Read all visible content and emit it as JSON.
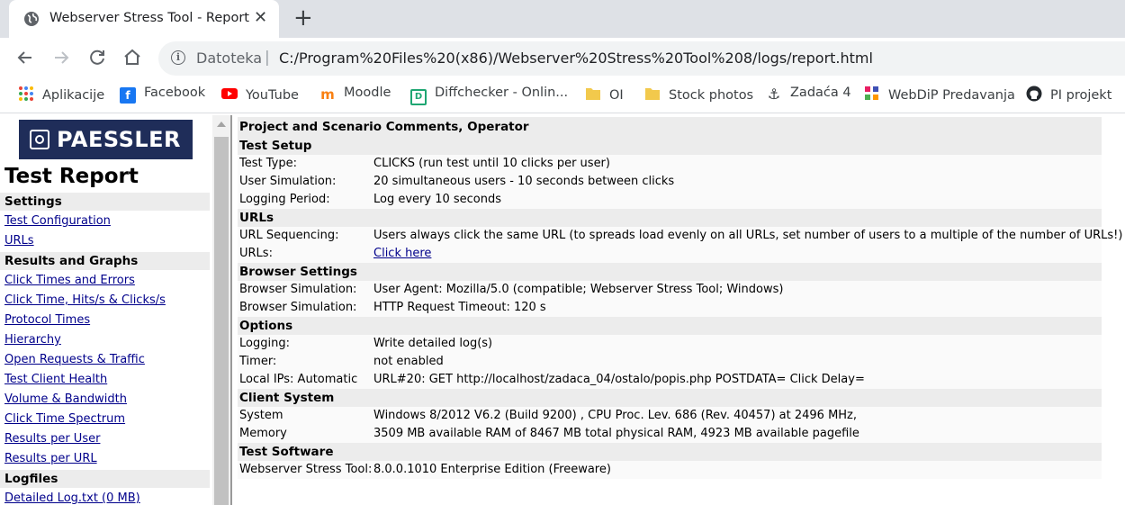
{
  "browser": {
    "tab_title": "Webserver Stress Tool - Report",
    "tab_close": "✕",
    "new_tab": "+",
    "scheme_label": "Datoteka",
    "separator": "|",
    "url": "C:/Program%20Files%20(x86)/Webserver%20Stress%20Tool%208/logs/report.html",
    "icons": [
      "back-icon",
      "forward-icon",
      "reload-icon",
      "home-icon",
      "info-icon"
    ]
  },
  "bookmarks": [
    {
      "label": "Aplikacije",
      "icon": "apps-grid-icon"
    },
    {
      "label": "Facebook",
      "icon": "facebook-icon"
    },
    {
      "label": "YouTube",
      "icon": "youtube-icon"
    },
    {
      "label": "Moodle",
      "icon": "moodle-icon"
    },
    {
      "label": "Diffchecker - Onlin...",
      "icon": "diffchecker-icon"
    },
    {
      "label": "OI",
      "icon": "folder-icon"
    },
    {
      "label": "Stock photos",
      "icon": "folder-icon"
    },
    {
      "label": "Zadaća 4",
      "icon": "anchor-icon"
    },
    {
      "label": "WebDiP Predavanja",
      "icon": "webdip-icon"
    },
    {
      "label": "PI projekt",
      "icon": "github-icon"
    }
  ],
  "sidebar": {
    "logo_text": "PAESSLER",
    "report_title": "Test Report",
    "sections": [
      {
        "heading": "Settings",
        "links": [
          "Test Configuration",
          "URLs"
        ]
      },
      {
        "heading": "Results and Graphs",
        "links": [
          "Click Times and Errors",
          "Click Time, Hits/s & Clicks/s",
          "Protocol Times",
          "Hierarchy",
          "Open Requests & Traffic",
          "Test Client Health",
          "Volume & Bandwidth",
          "Click Time Spectrum",
          "Results per User",
          "Results per URL"
        ]
      },
      {
        "heading": "Logfiles",
        "links": [
          "Detailed Log.txt (0 MB)"
        ]
      }
    ]
  },
  "report": {
    "top_heading": "Project and Scenario Comments, Operator",
    "sections": [
      {
        "heading": "Test Setup",
        "rows": [
          {
            "key": "Test Type:",
            "value": "CLICKS (run test until 10 clicks per user)"
          },
          {
            "key": "User Simulation:",
            "value": "20 simultaneous users - 10 seconds between clicks"
          },
          {
            "key": "Logging Period:",
            "value": "Log every 10 seconds"
          }
        ]
      },
      {
        "heading": "URLs",
        "rows": [
          {
            "key": "URL Sequencing:",
            "value": "Users always click the same URL (to spreads load evenly on all URLs, set number of users to a multiple of the number of URLs!)"
          },
          {
            "key": "URLs:",
            "value": "Click here",
            "link": true
          }
        ]
      },
      {
        "heading": "Browser Settings",
        "rows": [
          {
            "key": "Browser Simulation:",
            "value": "User Agent: Mozilla/5.0 (compatible; Webserver Stress Tool; Windows)"
          },
          {
            "key": "Browser Simulation:",
            "value": "HTTP Request Timeout: 120 s"
          }
        ]
      },
      {
        "heading": "Options",
        "rows": [
          {
            "key": "Logging:",
            "value": "Write detailed log(s)"
          },
          {
            "key": "Timer:",
            "value": "not enabled"
          },
          {
            "key": "Local IPs: Automatic",
            "value": "URL#20: GET http://localhost/zadaca_04/ostalo/popis.php POSTDATA= Click Delay="
          }
        ]
      },
      {
        "heading": "Client System",
        "rows": [
          {
            "key": "System",
            "value": "Windows 8/2012 V6.2 (Build 9200) , CPU Proc. Lev. 686 (Rev. 40457) at 2496 MHz,"
          },
          {
            "key": "Memory",
            "value": "3509 MB available RAM of 8467 MB total physical RAM, 4923 MB available pagefile"
          }
        ]
      },
      {
        "heading": "Test Software",
        "rows": [
          {
            "key": "Webserver Stress Tool:",
            "value": "8.0.0.1010 Enterprise Edition (Freeware)"
          }
        ]
      }
    ]
  }
}
